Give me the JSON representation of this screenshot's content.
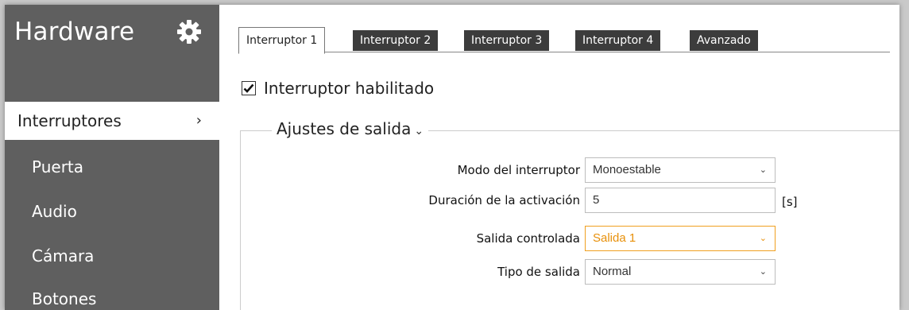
{
  "sidebar": {
    "title": "Hardware",
    "items": [
      {
        "label": "Interruptores",
        "active": true
      },
      {
        "label": "Puerta"
      },
      {
        "label": "Audio"
      },
      {
        "label": "Cámara"
      },
      {
        "label": "Botones"
      }
    ],
    "active_chevron": "›"
  },
  "tabs": [
    {
      "label": "Interruptor 1",
      "active": true
    },
    {
      "label": "Interruptor 2"
    },
    {
      "label": "Interruptor 3"
    },
    {
      "label": "Interruptor 4"
    },
    {
      "label": "Avanzado"
    }
  ],
  "enable": {
    "label": "Interruptor habilitado",
    "checked": true
  },
  "section": {
    "title": "Ajustes de salida",
    "chevron": "⌄"
  },
  "form": {
    "mode": {
      "label": "Modo del interruptor",
      "value": "Monoestable"
    },
    "duration": {
      "label": "Duración de la activación",
      "value": "5",
      "unit": "[s]"
    },
    "output": {
      "label": "Salida controlada",
      "value": "Salida 1"
    },
    "output_type": {
      "label": "Tipo de salida",
      "value": "Normal"
    },
    "select_arrow": "⌄"
  },
  "colors": {
    "sidebar_bg": "#5f5f5f",
    "tab_inactive_bg": "#3c3c3c",
    "focus_accent": "#f0a020"
  },
  "icons": {
    "settings": "gear-icon",
    "check": "checkmark-icon"
  }
}
